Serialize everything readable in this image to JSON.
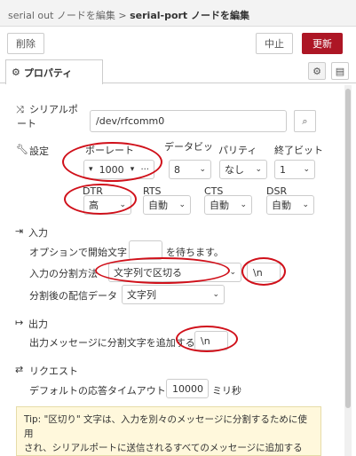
{
  "header": {
    "breadcrumb_prefix": "serial out ノードを編集 >",
    "breadcrumb_current": "serial-port ノードを編集"
  },
  "toolbar": {
    "delete_label": "削除",
    "cancel_label": "中止",
    "update_label": "更新"
  },
  "tabs": {
    "properties_label": "プロパティ"
  },
  "serial": {
    "label_line1": "シリアルポ",
    "label_line2": "ート",
    "path_value": "/dev/rfcomm0"
  },
  "settings": {
    "label": "設定",
    "baud_header": "ボーレート",
    "baud_value": "1000",
    "databits_header": "データビット",
    "databits_value": "8",
    "parity_header": "パリティ",
    "parity_value": "なし",
    "stopbits_header": "終了ビット",
    "stopbits_value": "1",
    "dtr_header": "DTR",
    "dtr_value": "高",
    "rts_header": "RTS",
    "rts_value": "自動",
    "cts_header": "CTS",
    "cts_value": "自動",
    "dsr_header": "DSR",
    "dsr_value": "自動"
  },
  "input": {
    "section_label": "入力",
    "wait_prefix": "オプションで開始文字",
    "wait_suffix": "を待ちます。",
    "wait_value": "",
    "split_label": "入力の分割方法",
    "split_value": "文字列で区切る",
    "split_char": "\\n",
    "deliver_label": "分割後の配信データ",
    "deliver_value": "文字列"
  },
  "output": {
    "section_label": "出力",
    "add_label": "出力メッセージに分割文字を追加する",
    "add_value": "\\n"
  },
  "request": {
    "section_label": "リクエスト",
    "timeout_label": "デフォルトの応答タイムアウト",
    "timeout_value": "10000",
    "timeout_unit": "ミリ秒"
  },
  "tip": {
    "line1": "Tip: \"区切り\" 文字は、入力を別々のメッセージに分割するために使用",
    "line2": "され、シリアルポートに送信されるすべてのメッセージに追加する"
  },
  "colors": {
    "accent_red": "#ad1625",
    "annotation_red": "#d0101a"
  }
}
